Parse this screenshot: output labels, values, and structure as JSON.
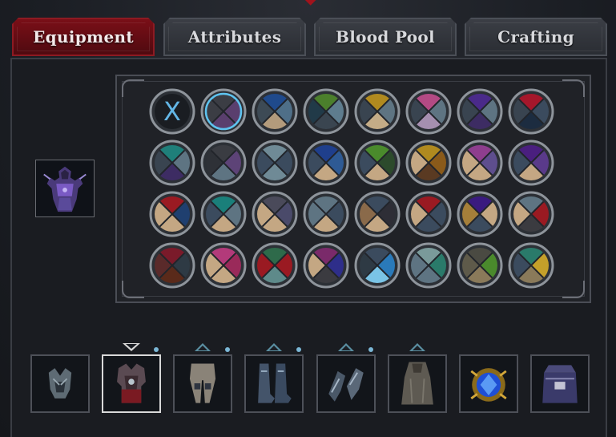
{
  "tabs": [
    {
      "label": "Equipment",
      "active": true
    },
    {
      "label": "Attributes",
      "active": false
    },
    {
      "label": "Blood Pool",
      "active": false
    },
    {
      "label": "Crafting",
      "active": false
    }
  ],
  "colors": {
    "accent": "#7a0f17",
    "ring": "#8e949b",
    "selected_ring": "#5ec3ef",
    "clear_icon": "#63b6e6"
  },
  "clear_swatch": {
    "symbol": "X",
    "icon": "clear-dye-icon"
  },
  "swatches": [
    [
      null,
      [
        "#3b3d44",
        "#5a3f6e",
        "#5a3f6e",
        "#3b3d44"
      ],
      [
        "#1f4a8c",
        "#4f6f88",
        "#b39b7c",
        "#3d4a55"
      ],
      [
        "#4b7f2c",
        "#5e7c8e",
        "#3a4550",
        "#213a48"
      ],
      [
        "#b18a1f",
        "#5e7482",
        "#c4ac87",
        "#394450"
      ],
      [
        "#b34a84",
        "#5e7482",
        "#a58fb0",
        "#394450"
      ],
      [
        "#4a2a8a",
        "#5e7482",
        "#3d2c63",
        "#394450"
      ],
      [
        "#a5172b",
        "#3b4b5e",
        "#1c2c40",
        "#394450"
      ]
    ],
    [
      [
        "#1f7f7a",
        "#5e7482",
        "#3d2c63",
        "#394450"
      ],
      [
        "#3a3c42",
        "#5d4377",
        "#5e7482",
        "#2e3137"
      ],
      [
        "#6f8a96",
        "#3b4b5e",
        "#6f8a96",
        "#3b4b5e"
      ],
      [
        "#1f3f8c",
        "#2e5a94",
        "#c4a783",
        "#3b4b5e"
      ],
      [
        "#4a8a2c",
        "#2c4a2c",
        "#c4a783",
        "#3b4b5e"
      ],
      [
        "#b08a1f",
        "#8a5a1a",
        "#5a3a22",
        "#c4a783"
      ],
      [
        "#8e3e8e",
        "#5e4e8e",
        "#c4a783",
        "#c4a783"
      ],
      [
        "#4a1f7f",
        "#5a3a8a",
        "#c4a783",
        "#3b4b5e"
      ]
    ],
    [
      [
        "#9a1a22",
        "#1f3f6f",
        "#c4a783",
        "#c4a783"
      ],
      [
        "#1a7f7a",
        "#5e7482",
        "#c4a783",
        "#3b4b5e"
      ],
      [
        "#4a4a5a",
        "#4a4a6a",
        "#c4a783",
        "#c4a783"
      ],
      [
        "#5e7482",
        "#3b4b5e",
        "#c4a783",
        "#5e7482"
      ],
      [
        "#3b4b5e",
        "#2e2e36",
        "#c4a783",
        "#8a6a4a"
      ],
      [
        "#9a1a22",
        "#3b4b5e",
        "#3b4b5e",
        "#c4a783"
      ],
      [
        "#3a1a7f",
        "#c4a783",
        "#3b4b5e",
        "#a57f3a"
      ],
      [
        "#5e7482",
        "#9a1a22",
        "#3b3b40",
        "#c4a783"
      ]
    ],
    [
      [
        "#7a1a2a",
        "#2e3a44",
        "#5a2a1a",
        "#5a2a2a"
      ],
      [
        "#b33a7a",
        "#9a2a5a",
        "#c4a783",
        "#c4a783"
      ],
      [
        "#2e6a4a",
        "#9a1a22",
        "#5e8a8a",
        "#9a1a22"
      ],
      [
        "#7a2a6a",
        "#2e2e8a",
        "#3b3b40",
        "#c4a783"
      ],
      [
        "#3b4b5e",
        "#2a7aba",
        "#7ac4e6",
        "#2e3a44"
      ],
      [
        "#7a9a9a",
        "#2a7a6a",
        "#5e7482",
        "#5e7482"
      ],
      [
        "#4a4a42",
        "#4a8a2c",
        "#8a7a5a",
        "#5e5a4a"
      ],
      [
        "#2a7a6a",
        "#c4a02a",
        "#8a7a5a",
        "#3b4b5e"
      ]
    ]
  ],
  "slots": [
    {
      "name": "helmet-slot",
      "icon": "helmet-icon",
      "indicator": "none"
    },
    {
      "name": "chest-slot",
      "icon": "chest-armor-icon",
      "indicator": "down",
      "selected": true
    },
    {
      "name": "legs-slot",
      "icon": "leg-armor-icon",
      "indicator": "up"
    },
    {
      "name": "boots-slot",
      "icon": "boots-icon",
      "indicator": "up"
    },
    {
      "name": "gloves-slot",
      "icon": "gloves-icon",
      "indicator": "up"
    },
    {
      "name": "cloak-slot",
      "icon": "cloak-icon",
      "indicator": "up-no-dot"
    },
    {
      "name": "amulet-slot",
      "icon": "amulet-icon",
      "indicator": "none"
    },
    {
      "name": "bag-slot",
      "icon": "bag-icon",
      "indicator": "none"
    }
  ],
  "preview_icon": "character-armor-preview-icon"
}
